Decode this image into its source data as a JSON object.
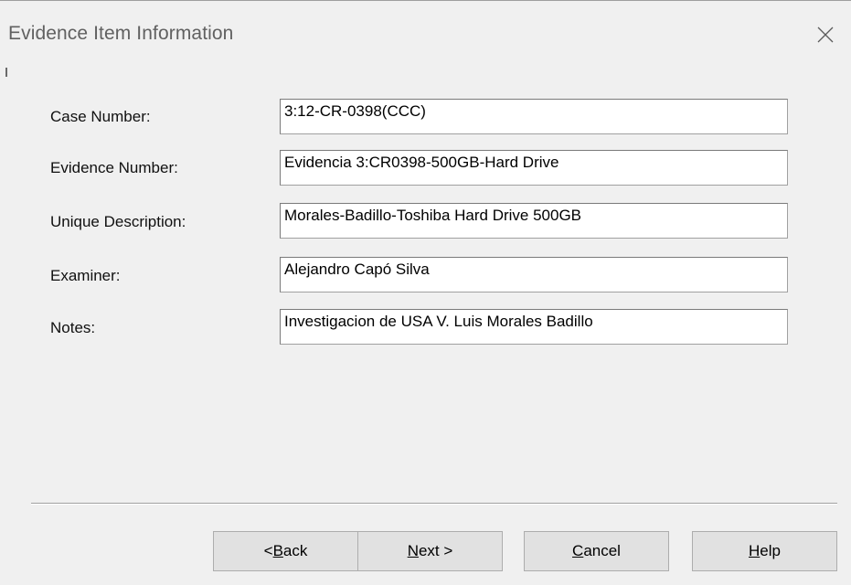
{
  "window": {
    "title": "Evidence Item Information",
    "close_icon": "close-icon"
  },
  "fields": [
    {
      "label": "Case Number:",
      "value": "3:12-CR-0398(CCC)"
    },
    {
      "label": "Evidence Number:",
      "value": "Evidencia 3:CR0398-500GB-Hard Drive"
    },
    {
      "label": "Unique Description:",
      "value": "Morales-Badillo-Toshiba Hard Drive 500GB"
    },
    {
      "label": "Examiner:",
      "value": "Alejandro Capó Silva"
    },
    {
      "label": "Notes:",
      "value": "Investigacion de USA V. Luis Morales Badillo"
    }
  ],
  "buttons": {
    "back": {
      "pre": "< ",
      "mnemonic": "B",
      "post": "ack"
    },
    "next": {
      "pre": "",
      "mnemonic": "N",
      "post": "ext >"
    },
    "cancel": {
      "pre": "",
      "mnemonic": "C",
      "post": "ancel"
    },
    "help": {
      "pre": "",
      "mnemonic": "H",
      "post": "elp"
    }
  }
}
